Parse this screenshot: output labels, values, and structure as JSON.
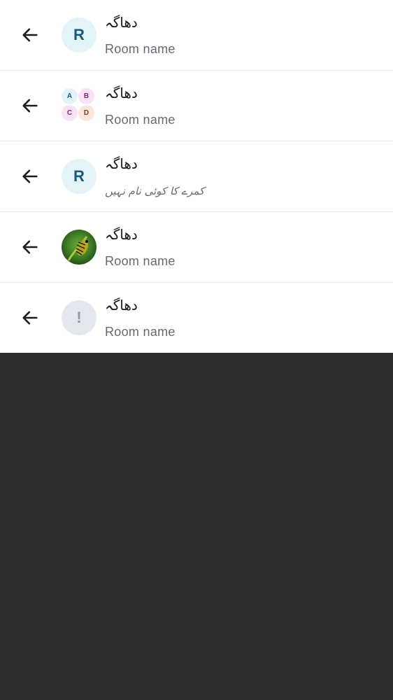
{
  "rooms": [
    {
      "title": "دھاگہ",
      "subtitle": "Room name",
      "avatar_type": "letter",
      "avatar_text": "R",
      "back_icon": "arrow-left-icon"
    },
    {
      "title": "دھاگہ",
      "subtitle": "Room name",
      "avatar_type": "grid",
      "avatar_letters": [
        "A",
        "B",
        "C",
        "D"
      ],
      "back_icon": "arrow-left-icon"
    },
    {
      "title": "دھاگہ",
      "subtitle": "کمرے کا کوئی نام نہیں",
      "avatar_type": "letter",
      "avatar_text": "R",
      "back_icon": "arrow-left-icon"
    },
    {
      "title": "دھاگہ",
      "subtitle": "Room name",
      "avatar_type": "image",
      "avatar_description": "caterpillar-photo",
      "back_icon": "arrow-left-icon"
    },
    {
      "title": "دھاگہ",
      "subtitle": "Room name",
      "avatar_type": "warning",
      "avatar_text": "!",
      "back_icon": "arrow-left-icon"
    }
  ],
  "colors": {
    "avatar_letter_bg": "#e3f4f8",
    "avatar_letter_fg": "#1b5a80",
    "subtitle": "#636a73",
    "background_below": "#2f2f2f"
  }
}
